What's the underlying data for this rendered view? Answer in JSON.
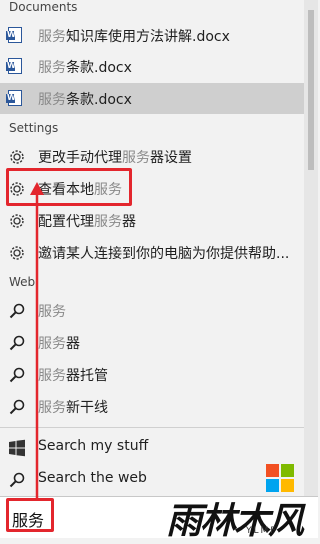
{
  "sections": {
    "documents": "Documents",
    "settings": "Settings",
    "web": "Web"
  },
  "documents": [
    {
      "hl": "服务",
      "rest": "知识库使用方法讲解.docx"
    },
    {
      "hl": "服务",
      "rest": "条款.docx"
    },
    {
      "hl": "服务",
      "rest": "条款.docx"
    }
  ],
  "settings": [
    {
      "pre": "更改手动代理",
      "hl": "服务",
      "post": "器设置"
    },
    {
      "pre": "查看本地",
      "hl": "服务",
      "post": ""
    },
    {
      "pre": "配置代理",
      "hl": "服务",
      "post": "器"
    },
    {
      "pre": "邀请某人连接到你的电脑为你提供帮助...",
      "hl": "",
      "post": ""
    }
  ],
  "web": [
    {
      "hl": "服务",
      "rest": ""
    },
    {
      "hl": "服务",
      "rest": "器"
    },
    {
      "hl": "服务",
      "rest": "器托管"
    },
    {
      "hl": "服务",
      "rest": "新干线"
    }
  ],
  "bottom": {
    "search_my_stuff": "Search my stuff",
    "search_web": "Search the web"
  },
  "search": {
    "value": "服务"
  },
  "watermark": {
    "logo": "雨林木风",
    "sub": "YLMF"
  },
  "colors": {
    "highlight": "#8a8a8a",
    "annotation": "#e3262d",
    "selected": "#cfcfcf"
  }
}
